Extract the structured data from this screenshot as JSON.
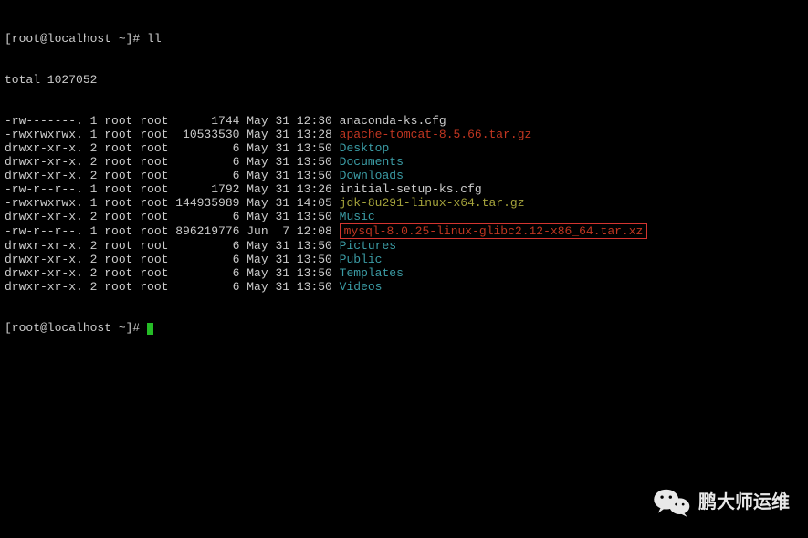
{
  "prompt1": "[root@localhost ~]# ",
  "cmd1": "ll",
  "total": "total 1027052",
  "rows": [
    {
      "perm": "-rw-------. 1 root root      1744 May 31 12:30 ",
      "name": "anaconda-ks.cfg",
      "cls": "white"
    },
    {
      "perm": "-rwxrwxrwx. 1 root root  10533530 May 31 13:28 ",
      "name": "apache-tomcat-8.5.66.tar.gz",
      "cls": "red"
    },
    {
      "perm": "drwxr-xr-x. 2 root root         6 May 31 13:50 ",
      "name": "Desktop",
      "cls": "cyan"
    },
    {
      "perm": "drwxr-xr-x. 2 root root         6 May 31 13:50 ",
      "name": "Documents",
      "cls": "cyan"
    },
    {
      "perm": "drwxr-xr-x. 2 root root         6 May 31 13:50 ",
      "name": "Downloads",
      "cls": "cyan"
    },
    {
      "perm": "-rw-r--r--. 1 root root      1792 May 31 13:26 ",
      "name": "initial-setup-ks.cfg",
      "cls": "white"
    },
    {
      "perm": "-rwxrwxrwx. 1 root root 144935989 May 31 14:05 ",
      "name": "jdk-8u291-linux-x64.tar.gz",
      "cls": "yellow"
    },
    {
      "perm": "drwxr-xr-x. 2 root root         6 May 31 13:50 ",
      "name": "Music",
      "cls": "cyan"
    },
    {
      "perm": "-rw-r--r--. 1 root root 896219776 Jun  7 12:08 ",
      "name": "mysql-8.0.25-linux-glibc2.12-x86_64.tar.xz",
      "cls": "red",
      "boxed": true
    },
    {
      "perm": "drwxr-xr-x. 2 root root         6 May 31 13:50 ",
      "name": "Pictures",
      "cls": "cyan"
    },
    {
      "perm": "drwxr-xr-x. 2 root root         6 May 31 13:50 ",
      "name": "Public",
      "cls": "cyan"
    },
    {
      "perm": "drwxr-xr-x. 2 root root         6 May 31 13:50 ",
      "name": "Templates",
      "cls": "cyan"
    },
    {
      "perm": "drwxr-xr-x. 2 root root         6 May 31 13:50 ",
      "name": "Videos",
      "cls": "cyan"
    }
  ],
  "prompt2": "[root@localhost ~]# ",
  "watermark": "鹏大师运维"
}
